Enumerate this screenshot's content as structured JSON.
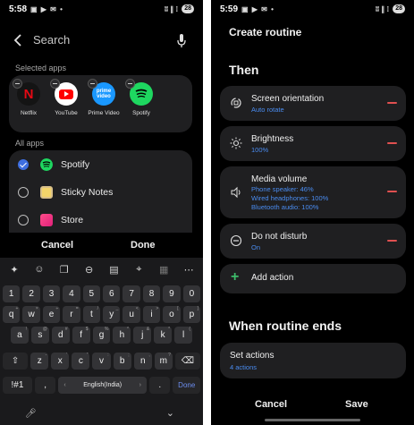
{
  "left": {
    "status": {
      "time": "5:58",
      "icons": "▣ ▶ ✉ •",
      "signal": "ʬ ∥ ⁞",
      "battery": "28"
    },
    "search": {
      "label": "Search"
    },
    "selected_apps": {
      "heading": "Selected apps",
      "apps": [
        {
          "name": "Netflix",
          "icon": "netflix-icon"
        },
        {
          "name": "YouTube",
          "icon": "youtube-icon"
        },
        {
          "name": "Prime Video",
          "icon": "prime-video-icon"
        },
        {
          "name": "Spotify",
          "icon": "spotify-icon"
        }
      ]
    },
    "all_apps": {
      "heading": "All apps",
      "items": [
        {
          "name": "Spotify",
          "checked": true,
          "icon": "spotify-icon"
        },
        {
          "name": "Sticky Notes",
          "checked": false,
          "icon": "sticky-notes-icon"
        },
        {
          "name": "Store",
          "checked": false,
          "icon": "store-icon"
        }
      ]
    },
    "dialog": {
      "cancel": "Cancel",
      "done": "Done"
    },
    "keyboard": {
      "toolbar": [
        "sparkle-icon",
        "emoji-icon",
        "sticker-icon",
        "gif-icon",
        "clipboard-icon",
        "cursor-control-icon",
        "translate-icon",
        "more-icon"
      ],
      "rows": [
        [
          "1",
          "2",
          "3",
          "4",
          "5",
          "6",
          "7",
          "8",
          "9",
          "0"
        ],
        [
          "q",
          "w",
          "e",
          "r",
          "t",
          "y",
          "u",
          "i",
          "o",
          "p"
        ],
        [
          "a",
          "s",
          "d",
          "f",
          "g",
          "h",
          "j",
          "k",
          "l"
        ],
        [
          "z",
          "x",
          "c",
          "v",
          "b",
          "n",
          "m"
        ]
      ],
      "row2_sup": [
        "+",
        "×",
        "÷",
        "=",
        "/",
        "_",
        "<",
        ">",
        "[",
        "]"
      ],
      "row3_sup": [
        "!",
        "@",
        "#",
        "$",
        "%",
        "^",
        "&",
        "*",
        "(",
        ")"
      ],
      "row4_sup": [
        "-",
        "'",
        "\"",
        ":",
        ";",
        ",",
        "?"
      ],
      "sym_key": "!#1",
      "comma_key": ",",
      "space_label": "English(India)",
      "period_key": ".",
      "done_key": "Done"
    }
  },
  "right": {
    "status": {
      "time": "5:59",
      "icons": "▣ ▶ ✉ •",
      "signal": "ʬ ∥ ⁞",
      "battery": "28"
    },
    "title": "Create routine",
    "then_heading": "Then",
    "actions": [
      {
        "title": "Screen orientation",
        "subs": [
          "Auto rotate"
        ],
        "icon": "screen-rotate-icon"
      },
      {
        "title": "Brightness",
        "subs": [
          "100%"
        ],
        "icon": "brightness-icon"
      },
      {
        "title": "Media volume",
        "subs": [
          "Phone speaker: 46%",
          "Wired headphones: 100%",
          "Bluetooth audio: 100%"
        ],
        "icon": "volume-icon"
      },
      {
        "title": "Do not disturb",
        "subs": [
          "On"
        ],
        "icon": "do-not-disturb-icon"
      }
    ],
    "add_action": "Add action",
    "ends_heading": "When routine ends",
    "set_actions": {
      "title": "Set actions",
      "sub": "4 actions"
    },
    "buttons": {
      "cancel": "Cancel",
      "save": "Save"
    }
  },
  "colors": {
    "accent_blue": "#4a8cf0",
    "remove_red": "#e05050",
    "add_green": "#3dbb6a",
    "card_bg": "#1f1f21"
  }
}
